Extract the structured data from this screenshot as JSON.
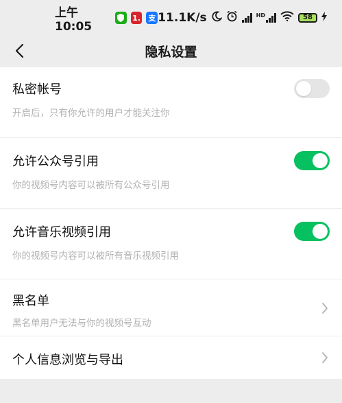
{
  "status_bar": {
    "time": "上午10:05",
    "app_badge_2": "1.",
    "app_badge_3": "支",
    "network_speed": "11.1K/s",
    "network_type": "HD",
    "battery_level": "58",
    "colors": {
      "shield": "#1aad19",
      "red_badge": "#d9242b",
      "alipay": "#1677ff"
    }
  },
  "nav": {
    "title": "隐私设置",
    "back_icon": "chevron-left-icon"
  },
  "settings": [
    {
      "title": "私密帐号",
      "subtitle": "开启后，只有你允许的用户才能关注你",
      "control": "toggle",
      "enabled": false
    },
    {
      "title": "允许公众号引用",
      "subtitle": "你的视频号内容可以被所有公众号引用",
      "control": "toggle",
      "enabled": true
    },
    {
      "title": "允许音乐视频引用",
      "subtitle": "你的视频号内容可以被所有音乐视频引用",
      "control": "toggle",
      "enabled": true
    },
    {
      "title": "黑名单",
      "subtitle": "黑名单用户无法与你的视频号互动",
      "control": "chevron"
    },
    {
      "title": "个人信息浏览与导出",
      "control": "chevron"
    }
  ],
  "colors": {
    "toggle_on": "#07c160",
    "toggle_off": "#e5e5e5",
    "page_background": "#ededed"
  }
}
